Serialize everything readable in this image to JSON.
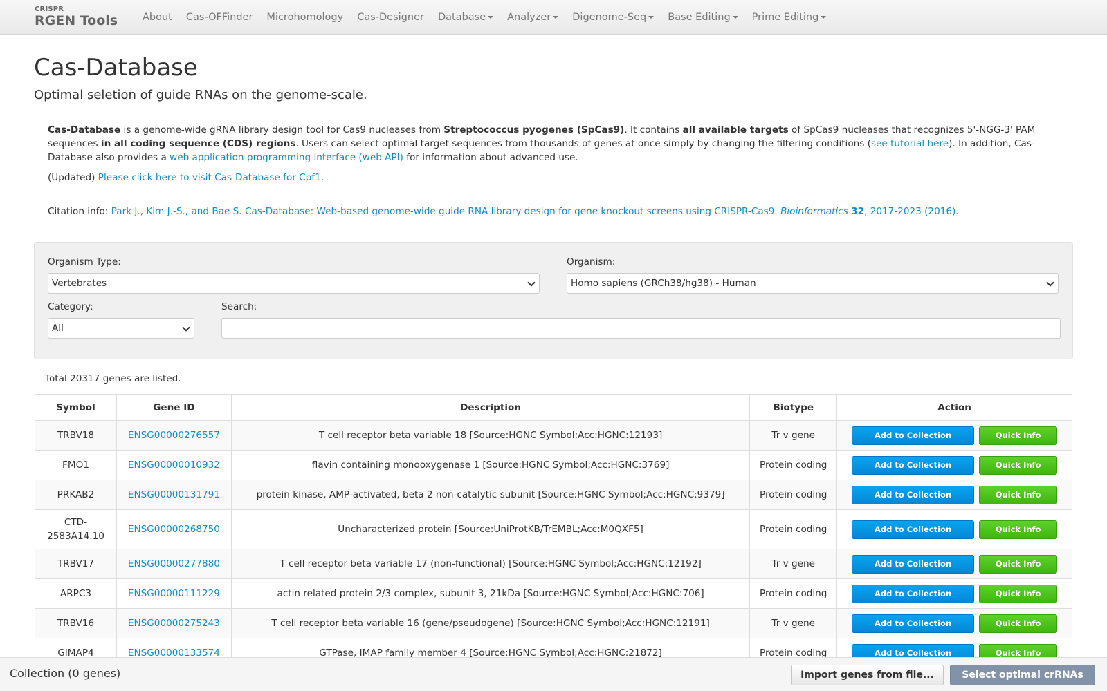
{
  "brand": {
    "small": "CRISPR",
    "big": "RGEN Tools"
  },
  "nav": [
    {
      "label": "About",
      "dropdown": false
    },
    {
      "label": "Cas-OFFinder",
      "dropdown": false
    },
    {
      "label": "Microhomology",
      "dropdown": false
    },
    {
      "label": "Cas-Designer",
      "dropdown": false
    },
    {
      "label": "Database",
      "dropdown": true
    },
    {
      "label": "Analyzer",
      "dropdown": true
    },
    {
      "label": "Digenome-Seq",
      "dropdown": true
    },
    {
      "label": "Base Editing",
      "dropdown": true
    },
    {
      "label": "Prime Editing",
      "dropdown": true
    }
  ],
  "page": {
    "title": "Cas-Database",
    "subtitle": "Optimal seletion of guide RNAs on the genome-scale."
  },
  "intro": {
    "t1_bold": "Cas-Database",
    "t2": " is a genome-wide gRNA library design tool for Cas9 nucleases from ",
    "t3_bold": "Streptococcus pyogenes (SpCas9)",
    "t4": ". It contains ",
    "t5_bold": "all available targets",
    "t6": " of SpCas9 nucleases that recognizes 5'-NGG-3' PAM sequences ",
    "t7_bold": "in all coding sequence (CDS) regions",
    "t8": ". Users can select optimal target sequences from thousands of genes at once simply by changing the filtering conditions (",
    "t9_link": "see tutorial here",
    "t10": "). In addition, Cas-Database also provides a ",
    "t11_link": "web application programming interface (web API)",
    "t12": " for information about advanced use."
  },
  "updated": {
    "prefix": "(Updated) ",
    "link": "Please click here to visit Cas-Database for Cpf1",
    "suffix": "."
  },
  "citation": {
    "label": "Citation info: ",
    "authors": "Park J., Kim J.-S., and Bae S. Cas-Database: Web-based genome-wide guide RNA library design for gene knockout screens using CRISPR-Cas9. ",
    "journal": "Bioinformatics",
    "sp": " ",
    "volume": "32",
    "pages": ", 2017-2023 (2016)."
  },
  "filters": {
    "organism_type_label": "Organism Type:",
    "organism_type_value": "Vertebrates",
    "organism_label": "Organism:",
    "organism_value": "Homo sapiens (GRCh38/hg38) - Human",
    "category_label": "Category:",
    "category_value": "All",
    "search_label": "Search:",
    "search_value": ""
  },
  "total_text": "Total 20317 genes are listed.",
  "table": {
    "headers": [
      "Symbol",
      "Gene ID",
      "Description",
      "Biotype",
      "Action"
    ],
    "add_label": "Add to Collection",
    "info_label": "Quick Info",
    "rows": [
      {
        "symbol": "TRBV18",
        "gene_id": "ENSG00000276557",
        "description": "T cell receptor beta variable 18 [Source:HGNC Symbol;Acc:HGNC:12193]",
        "biotype": "Tr v gene"
      },
      {
        "symbol": "FMO1",
        "gene_id": "ENSG00000010932",
        "description": "flavin containing monooxygenase 1 [Source:HGNC Symbol;Acc:HGNC:3769]",
        "biotype": "Protein coding"
      },
      {
        "symbol": "PRKAB2",
        "gene_id": "ENSG00000131791",
        "description": "protein kinase, AMP-activated, beta 2 non-catalytic subunit [Source:HGNC Symbol;Acc:HGNC:9379]",
        "biotype": "Protein coding"
      },
      {
        "symbol": "CTD-2583A14.10",
        "gene_id": "ENSG00000268750",
        "description": "Uncharacterized protein [Source:UniProtKB/TrEMBL;Acc:M0QXF5]",
        "biotype": "Protein coding"
      },
      {
        "symbol": "TRBV17",
        "gene_id": "ENSG00000277880",
        "description": "T cell receptor beta variable 17 (non-functional) [Source:HGNC Symbol;Acc:HGNC:12192]",
        "biotype": "Tr v gene"
      },
      {
        "symbol": "ARPC3",
        "gene_id": "ENSG00000111229",
        "description": "actin related protein 2/3 complex, subunit 3, 21kDa [Source:HGNC Symbol;Acc:HGNC:706]",
        "biotype": "Protein coding"
      },
      {
        "symbol": "TRBV16",
        "gene_id": "ENSG00000275243",
        "description": "T cell receptor beta variable 16 (gene/pseudogene) [Source:HGNC Symbol;Acc:HGNC:12191]",
        "biotype": "Tr v gene"
      },
      {
        "symbol": "GIMAP4",
        "gene_id": "ENSG00000133574",
        "description": "GTPase, IMAP family member 4 [Source:HGNC Symbol;Acc:HGNC:21872]",
        "biotype": "Protein coding"
      }
    ]
  },
  "collection": {
    "label": "Collection (0 genes)",
    "import_label": "Import genes from file...",
    "select_label": "Select optimal crRNAs"
  }
}
